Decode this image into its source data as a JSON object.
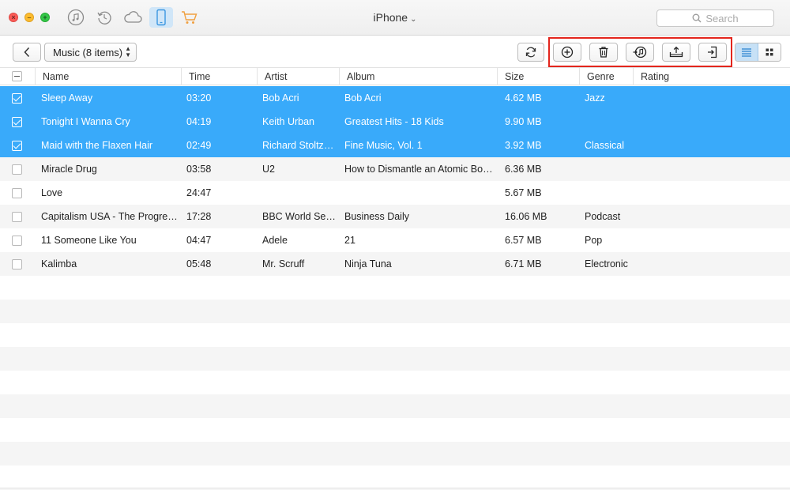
{
  "window": {
    "device_title": "iPhone",
    "device_chevron": "⌄"
  },
  "top_icons": [
    {
      "name": "music-library-icon"
    },
    {
      "name": "backup-restore-icon"
    },
    {
      "name": "icloud-icon"
    },
    {
      "name": "iphone-device-icon",
      "active": true
    },
    {
      "name": "shopping-cart-icon"
    }
  ],
  "search": {
    "placeholder": "Search"
  },
  "toolbar": {
    "category_label": "Music (8 items)",
    "back_icon": "chevron-left-icon",
    "action_icons": [
      "refresh-icon",
      "add-icon",
      "delete-icon",
      "to-itunes-icon",
      "to-computer-icon",
      "to-device-icon"
    ],
    "view_icons": [
      "list-view-icon",
      "grid-view-icon"
    ],
    "highlight_color": "#e3261d"
  },
  "table": {
    "columns": [
      "Name",
      "Time",
      "Artist",
      "Album",
      "Size",
      "Genre",
      "Rating"
    ],
    "rows": [
      {
        "name": "Sleep Away",
        "time": "03:20",
        "artist": "Bob Acri",
        "album": "Bob Acri",
        "size": "4.62 MB",
        "genre": "Jazz",
        "selected": true
      },
      {
        "name": "Tonight I Wanna Cry",
        "time": "04:19",
        "artist": "Keith Urban",
        "album": "Greatest Hits - 18 Kids",
        "size": "9.90 MB",
        "genre": "",
        "selected": true
      },
      {
        "name": "Maid with the Flaxen Hair",
        "time": "02:49",
        "artist": "Richard Stoltzm…",
        "album": "Fine Music, Vol. 1",
        "size": "3.92 MB",
        "genre": "Classical",
        "selected": true
      },
      {
        "name": "Miracle Drug",
        "time": "03:58",
        "artist": "U2",
        "album": "How to Dismantle an Atomic Bomb",
        "size": "6.36 MB",
        "genre": "",
        "selected": false
      },
      {
        "name": "Love",
        "time": "24:47",
        "artist": "",
        "album": "",
        "size": "5.67 MB",
        "genre": "",
        "selected": false
      },
      {
        "name": "Capitalism USA - The Progres…",
        "time": "17:28",
        "artist": "BBC World Service",
        "album": "Business Daily",
        "size": "16.06 MB",
        "genre": "Podcast",
        "selected": false
      },
      {
        "name": "11 Someone Like You",
        "time": "04:47",
        "artist": "Adele",
        "album": "21",
        "size": "6.57 MB",
        "genre": "Pop",
        "selected": false
      },
      {
        "name": "Kalimba",
        "time": "05:48",
        "artist": "Mr. Scruff",
        "album": "Ninja Tuna",
        "size": "6.71 MB",
        "genre": "Electronic",
        "selected": false
      }
    ],
    "selection_color": "#39aafa"
  }
}
